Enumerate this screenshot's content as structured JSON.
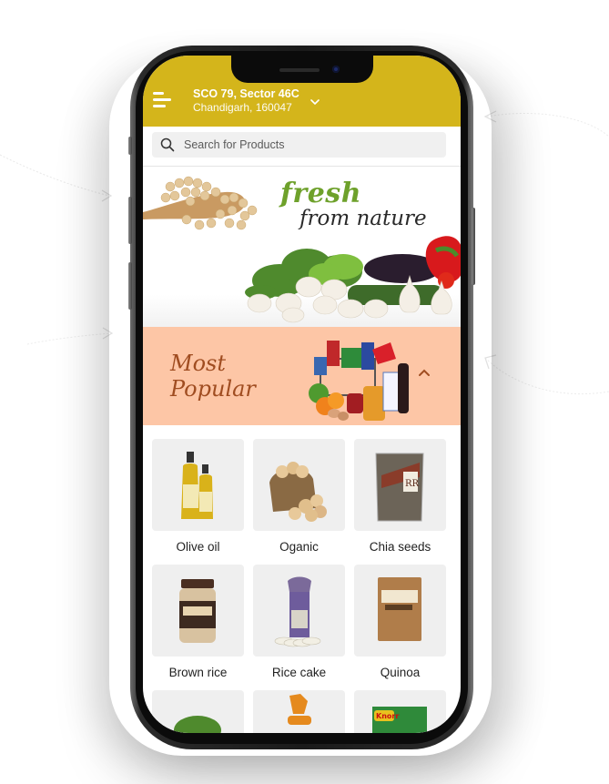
{
  "header": {
    "address_line1": "SCO 79, Sector 46C",
    "address_line2": "Chandigarh, 160047",
    "menu_icon": "hamburger-menu-icon",
    "dropdown_icon": "chevron-down-icon"
  },
  "search": {
    "placeholder": "Search for Products",
    "icon": "search-icon"
  },
  "banner": {
    "headline_1": "fresh",
    "headline_2": "from nature"
  },
  "popular": {
    "title_1": "Most",
    "title_2": "Popular",
    "toggle_icon": "chevron-up-icon"
  },
  "products": [
    {
      "label": "Olive oil"
    },
    {
      "label": "Oganic"
    },
    {
      "label": "Chia seeds"
    },
    {
      "label": "Brown rice"
    },
    {
      "label": "Rice cake"
    },
    {
      "label": "Quinoa"
    },
    {
      "label": ""
    },
    {
      "label": ""
    },
    {
      "label": ""
    }
  ],
  "colors": {
    "header_bg": "#d4b51b",
    "popular_bg": "#fdc6a6",
    "popular_text": "#a04d21",
    "fresh_green": "#6ea12b"
  }
}
